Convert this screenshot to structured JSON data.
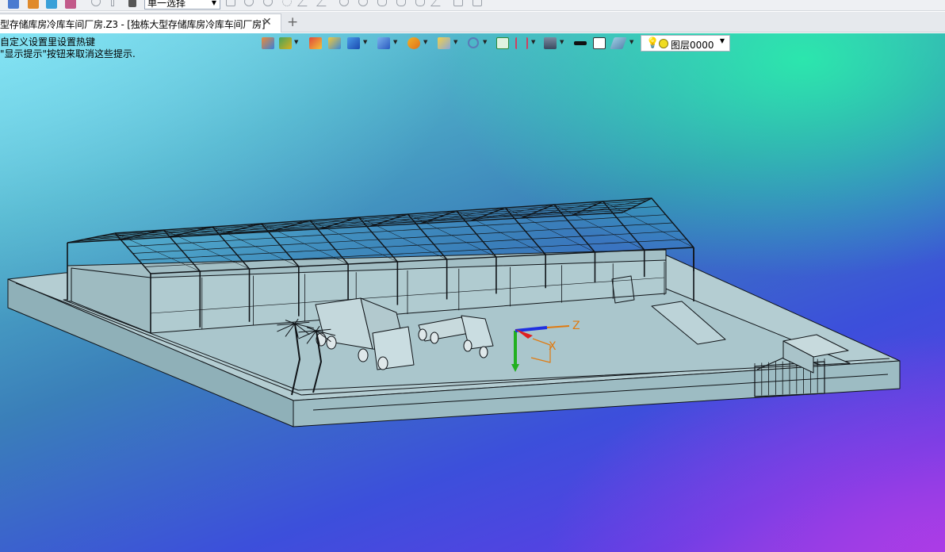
{
  "toolbar": {
    "select_mode": "单一选择"
  },
  "document": {
    "tab_title": "型存储库房冷库车间厂房.Z3 - [独栋大型存储库房冷库车间厂房]",
    "close_glyph": "✕",
    "new_tab_glyph": "+"
  },
  "hint": {
    "line1": "自定义设置里设置热键",
    "line2": "\"显示提示\"按钮来取消这些提示."
  },
  "view_toolbar": {
    "layer_value": "图层0000"
  },
  "triad": {
    "x_label": "X",
    "z_label": "Z"
  },
  "colors": {
    "model_fill": "#a9c3c9",
    "model_line": "#101418",
    "triad_x": "#e07a10",
    "triad_y": "#22b020",
    "triad_z": "#2030e0"
  }
}
